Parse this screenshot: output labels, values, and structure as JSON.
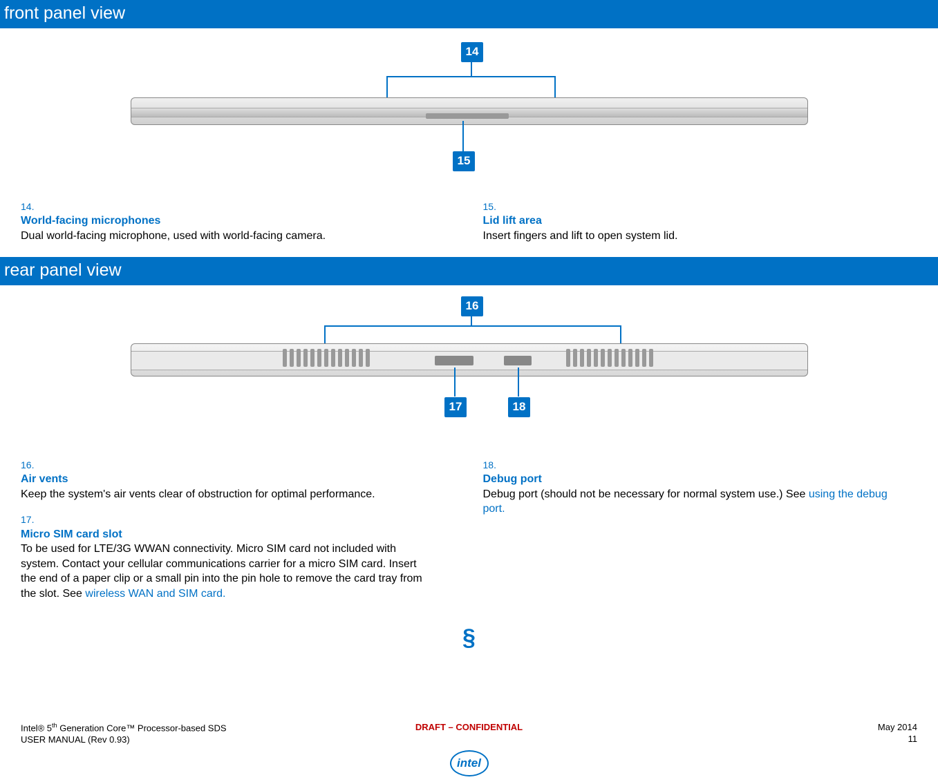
{
  "sections": {
    "front": {
      "title": "front panel view",
      "callouts": {
        "c14": "14",
        "c15": "15"
      },
      "items": [
        {
          "num": "14.",
          "title": "World-facing microphones",
          "desc": "Dual world-facing microphone, used with world-facing camera."
        },
        {
          "num": "15.",
          "title": "Lid lift area",
          "desc": "Insert fingers and lift to open system lid."
        }
      ]
    },
    "rear": {
      "title": "rear panel view",
      "callouts": {
        "c16": "16",
        "c17": "17",
        "c18": "18"
      },
      "items_left": [
        {
          "num": "16.",
          "title": "Air vents",
          "desc": "Keep the system's air vents clear of obstruction for optimal performance."
        },
        {
          "num": "17.",
          "title": "Micro SIM card slot",
          "desc": "To be used for LTE/3G WWAN connectivity. Micro SIM card not included with system. Contact your cellular communications carrier for a micro SIM card. Insert the end of a paper clip or a small pin into the pin hole to remove the card tray from the slot. See ",
          "link": "wireless WAN and SIM card."
        }
      ],
      "items_right": [
        {
          "num": "18.",
          "title": "Debug port",
          "desc": "Debug port (should not be necessary for normal system use.) See ",
          "link": "using the debug port."
        }
      ]
    }
  },
  "section_end": "§",
  "footer": {
    "line1_left": "Intel® 5",
    "line1_left_sup": "th",
    "line1_left_cont": " Generation Core™ Processor-based SDS",
    "line2_left": "USER MANUAL (Rev 0.93)",
    "center": "DRAFT – CONFIDENTIAL",
    "right1": "May 2014",
    "right2": "11",
    "logo_text": "intel"
  }
}
